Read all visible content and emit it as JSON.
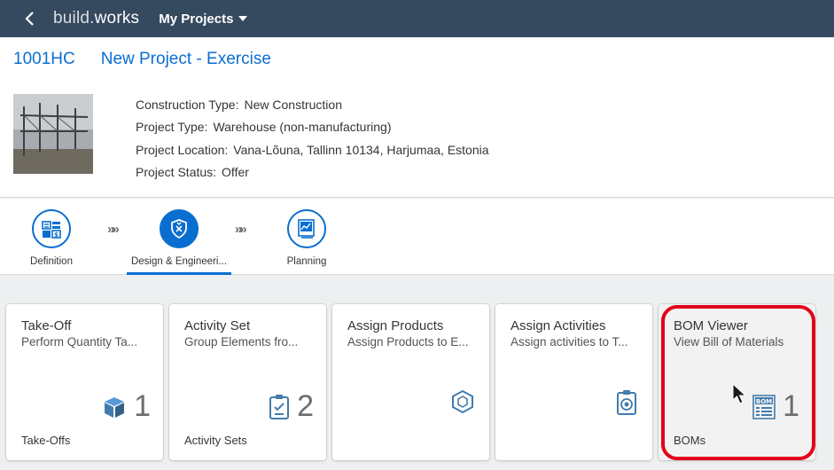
{
  "shell": {
    "logo_a": "build.",
    "logo_b": "works",
    "title": "My Projects"
  },
  "project": {
    "id": "1001HC",
    "name": "New Project - Exercise"
  },
  "attributes": [
    {
      "label": "Construction Type:",
      "value": "New Construction"
    },
    {
      "label": "Project Type:",
      "value": "Warehouse (non-manufacturing)"
    },
    {
      "label": "Project Location:",
      "value": "Vana-Lõuna, Tallinn 10134, Harjumaa, Estonia"
    },
    {
      "label": "Project Status:",
      "value": "Offer"
    }
  ],
  "flow": {
    "steps": [
      {
        "label": "Definition",
        "icon": "definition-icon"
      },
      {
        "label": "Design & Engineeri...",
        "icon": "shield-icon",
        "active": true
      },
      {
        "label": "Planning",
        "icon": "planning-icon"
      }
    ],
    "separator": "»»"
  },
  "tiles": [
    {
      "title": "Take-Off",
      "subtitle": "Perform Quantity Ta...",
      "count": "1",
      "footer": "Take-Offs",
      "icon": "cube-icon"
    },
    {
      "title": "Activity Set",
      "subtitle": "Group Elements fro...",
      "count": "2",
      "footer": "Activity Sets",
      "icon": "clipboard-check-icon"
    },
    {
      "title": "Assign Products",
      "subtitle": "Assign Products to E...",
      "count": "",
      "footer": "",
      "icon": "product-icon"
    },
    {
      "title": "Assign Activities",
      "subtitle": "Assign activities to T...",
      "count": "",
      "footer": "",
      "icon": "activity-icon"
    },
    {
      "title": "BOM Viewer",
      "subtitle": "View Bill of Materials",
      "count": "1",
      "footer": "BOMs",
      "icon": "bom-icon",
      "bom_badge": "BOM"
    }
  ],
  "colors": {
    "shell": "#354a5f",
    "accent": "#0a6ed1",
    "highlight": "#e3001b"
  }
}
